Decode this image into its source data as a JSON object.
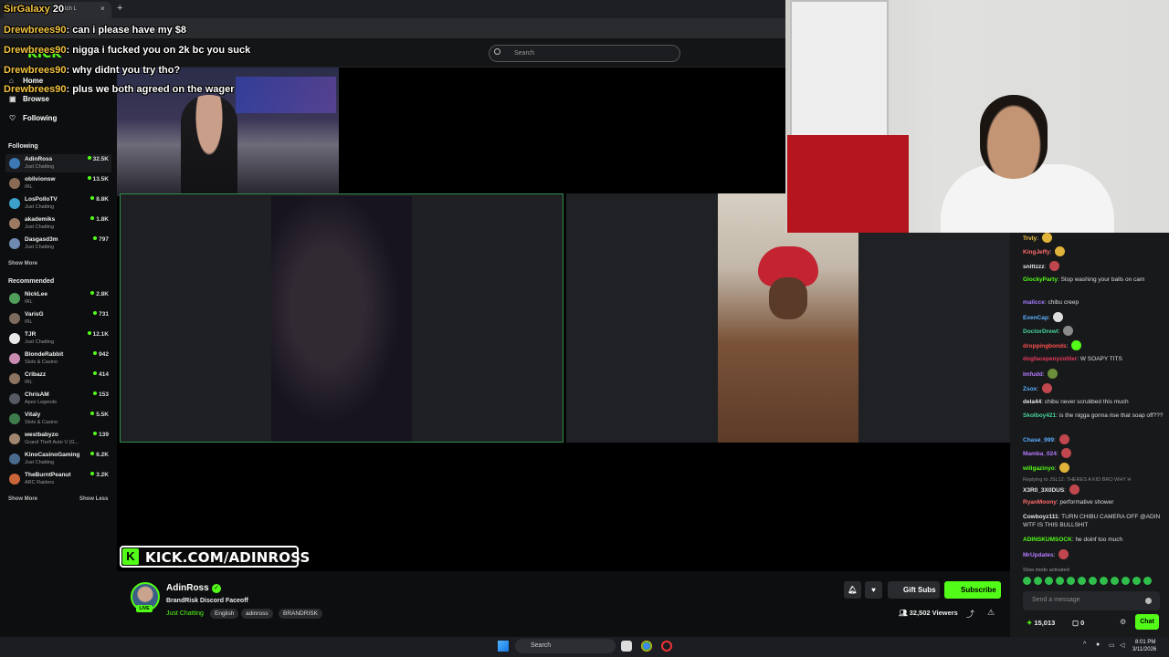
{
  "browser": {
    "tab_title": "Watch L",
    "new_tab": "+",
    "close": "×"
  },
  "header": {
    "search_placeholder": "Search",
    "logo": "KICK"
  },
  "nav": {
    "main": [
      {
        "label": "Home",
        "icon": "home-icon"
      },
      {
        "label": "Browse",
        "icon": "browse-icon"
      },
      {
        "label": "Following",
        "icon": "heart-icon"
      }
    ],
    "following_header": "Following",
    "following": [
      {
        "name": "AdinRoss",
        "category": "Just Chatting",
        "viewers": "32.5K",
        "color": "#3b78b5"
      },
      {
        "name": "oblivionsw",
        "category": "IRL",
        "viewers": "13.5K",
        "color": "#8a6a55"
      },
      {
        "name": "LosPolloTV",
        "category": "Just Chatting",
        "viewers": "8.8K",
        "color": "#3aa0c9"
      },
      {
        "name": "akademiks",
        "category": "Just Chatting",
        "viewers": "1.8K",
        "color": "#9c7a62"
      },
      {
        "name": "Dasgasd3m",
        "category": "Just Chatting",
        "viewers": "797",
        "color": "#6f8ab0"
      }
    ],
    "show_more_1": "Show More",
    "recommended_header": "Recommended",
    "recommended": [
      {
        "name": "NickLee",
        "category": "IRL",
        "viewers": "2.8K",
        "color": "#4f9e5a"
      },
      {
        "name": "VarisG",
        "category": "IRL",
        "viewers": "731",
        "color": "#7d6b5e"
      },
      {
        "name": "TJR",
        "category": "Just Chatting",
        "viewers": "12.1K",
        "color": "#e8e8e8"
      },
      {
        "name": "BlondeRabbit",
        "category": "Slots & Casino",
        "viewers": "942",
        "color": "#c98bb0"
      },
      {
        "name": "Cribazz",
        "category": "IRL",
        "viewers": "414",
        "color": "#8c7461"
      },
      {
        "name": "ChrisAM",
        "category": "Apex Legends",
        "viewers": "153",
        "color": "#555a63"
      },
      {
        "name": "Vitaly",
        "category": "Slots & Casino",
        "viewers": "5.5K",
        "color": "#3e7d4b"
      },
      {
        "name": "westbabyzo",
        "category": "Grand Theft Auto V (G...",
        "viewers": "139",
        "color": "#a0866f"
      },
      {
        "name": "KinoCasinoGaming",
        "category": "Just Chatting",
        "viewers": "6.2K",
        "color": "#4a6b8c"
      },
      {
        "name": "TheBurntPeanut",
        "category": "ARC Raiders",
        "viewers": "3.2K",
        "color": "#c9673a"
      }
    ],
    "show_more_2": "Show More",
    "show_less": "Show Less"
  },
  "overlay_chat": [
    {
      "user": "SirGalaxy",
      "text": "20",
      "sep": " "
    },
    {
      "user": "Drewbrees90",
      "text": "can i please have my $8",
      "sep": ": "
    },
    {
      "user": "Drewbrees90",
      "text": "nigga i fucked you on 2k bc you suck",
      "sep": ": "
    },
    {
      "user": "Drewbrees90",
      "text": "why didnt you try tho?",
      "sep": ": "
    },
    {
      "user": "Drewbrees90",
      "text": "plus we both agreed on the wager",
      "sep": ": "
    }
  ],
  "stream": {
    "url_banner": "KICK.COM/ADINROSS",
    "url_k": "K"
  },
  "channel": {
    "name": "AdinRoss",
    "title": "BrandRisk Discord Faceoff",
    "category": "Just Chatting",
    "tags": [
      "English",
      "adinross",
      "BRANDRISK"
    ],
    "viewers": "32,502 Viewers",
    "live": "LIVE",
    "gift_label": "Gift Subs",
    "subscribe_label": "Subscribe"
  },
  "chat": {
    "messages": [
      {
        "user": "Trvly",
        "text": "",
        "color": "#f4c542",
        "emote": "#e0b43a"
      },
      {
        "user": "KingJeffy",
        "text": "",
        "color": "#ff6b6b",
        "emote": "#e0b43a"
      },
      {
        "user": "snittzzz",
        "text": "",
        "color": "#e8e8e8",
        "emote": "#c0474d"
      },
      {
        "user": "GlockyParty",
        "text": "Stop washing your balls on cam",
        "color": "#53fc18",
        "emote": ""
      },
      {
        "user": "malicce",
        "text": "chibu creep",
        "color": "#a67bff",
        "emote": ""
      },
      {
        "user": "EvenCap",
        "text": "",
        "color": "#5ab0ff",
        "emote": "#dddddd"
      },
      {
        "user": "DoctorDrewl",
        "text": "",
        "color": "#46d39a",
        "emote": "#8a8a8a"
      },
      {
        "user": "droppingbonds",
        "text": "",
        "color": "#ff4f4f",
        "emote": "#53fc18"
      },
      {
        "user": "dogfacepenyzoltler",
        "text": "W SOAPY TITS",
        "color": "#e63b5a",
        "emote": ""
      },
      {
        "user": "Imfudd",
        "text": "",
        "color": "#b57bff",
        "emote": "#6b8f3a"
      },
      {
        "user": "Zsox",
        "text": "",
        "color": "#5ab0ff",
        "emote": "#c0474d"
      },
      {
        "user": "dela44",
        "text": "chibu never scrubbed this much",
        "color": "#e8e8e8",
        "emote": ""
      },
      {
        "user": "Skolboy421",
        "text": "is the nigga gonna rise that soap off???",
        "color": "#46d39a",
        "emote": ""
      },
      {
        "user": "Chase_999",
        "text": "",
        "color": "#5ab0ff",
        "emote": "#c0474d"
      },
      {
        "user": "Mamba_024",
        "text": "",
        "color": "#b57bff",
        "emote": "#c0474d"
      },
      {
        "user": "willgazinyo",
        "text": "",
        "color": "#53fc18",
        "emote": "#e0b43a"
      },
      {
        "user": "X3R0_3X0DUS",
        "text": "",
        "color": "#e8e8e8",
        "emote": "#c0474d"
      },
      {
        "user": "RyanMoony",
        "text": "performative shower",
        "color": "#ff6b6b",
        "emote": ""
      },
      {
        "user": "Cowboyz111",
        "text": "TURN CHIBU CAMERA OFF @ADIN WTF IS THIS BULLSHIT",
        "color": "#e8e8e8",
        "emote": ""
      },
      {
        "user": "ADINSKUMSOCK",
        "text": "he doinf too much",
        "color": "#53fc18",
        "emote": ""
      },
      {
        "user": "MrUpdates",
        "text": "",
        "color": "#b57bff",
        "emote": "#c0474d"
      }
    ],
    "reply_note": "Replying to JSL12: THERES A KID BRO WHY H",
    "slow_mode": "Slow mode activated",
    "input_placeholder": "Send a message",
    "points": "15,013",
    "kicks": "0",
    "chat_button": "Chat"
  },
  "taskbar": {
    "search": "Search",
    "time": "8:01 PM",
    "date": "3/11/2026"
  }
}
